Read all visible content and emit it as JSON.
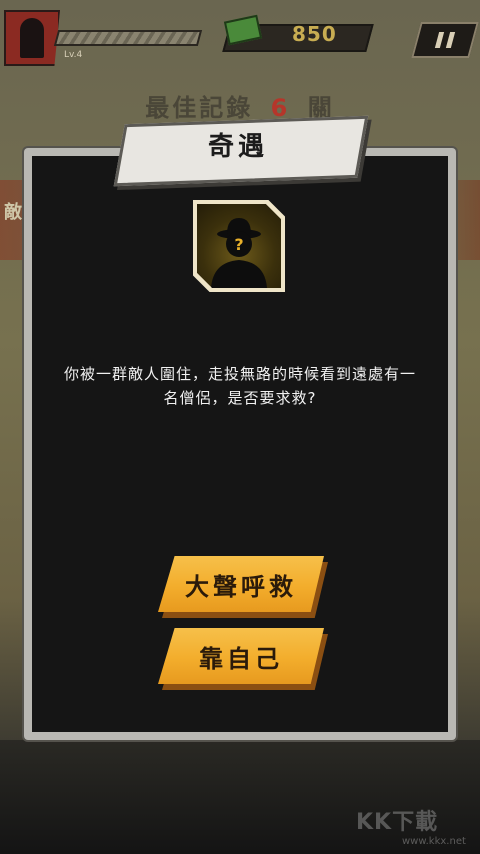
{
  "hud": {
    "level": "Lv.4",
    "cash": "850",
    "pause_icon": "pause-icon",
    "cash_icon": "cash-icon"
  },
  "best_record": {
    "prefix": "最佳記錄",
    "value": "6",
    "suffix": "關"
  },
  "background": {
    "side_text": "敵"
  },
  "dialog": {
    "title": "奇遇",
    "portrait_icon": "mystery-person-icon",
    "story_line1": "你被一群敵人圍住，走投無路的時候看到遠處有一",
    "story_line2": "名僧侶，是否要求救?",
    "choices": [
      {
        "label": "大聲呼救"
      },
      {
        "label": "靠自己"
      }
    ]
  },
  "watermark": {
    "text": "KK下載",
    "url": "www.kkx.net"
  },
  "colors": {
    "button_yellow": "#f3ad2c",
    "dialog_bg": "#151515",
    "record_red": "#b5362a"
  }
}
